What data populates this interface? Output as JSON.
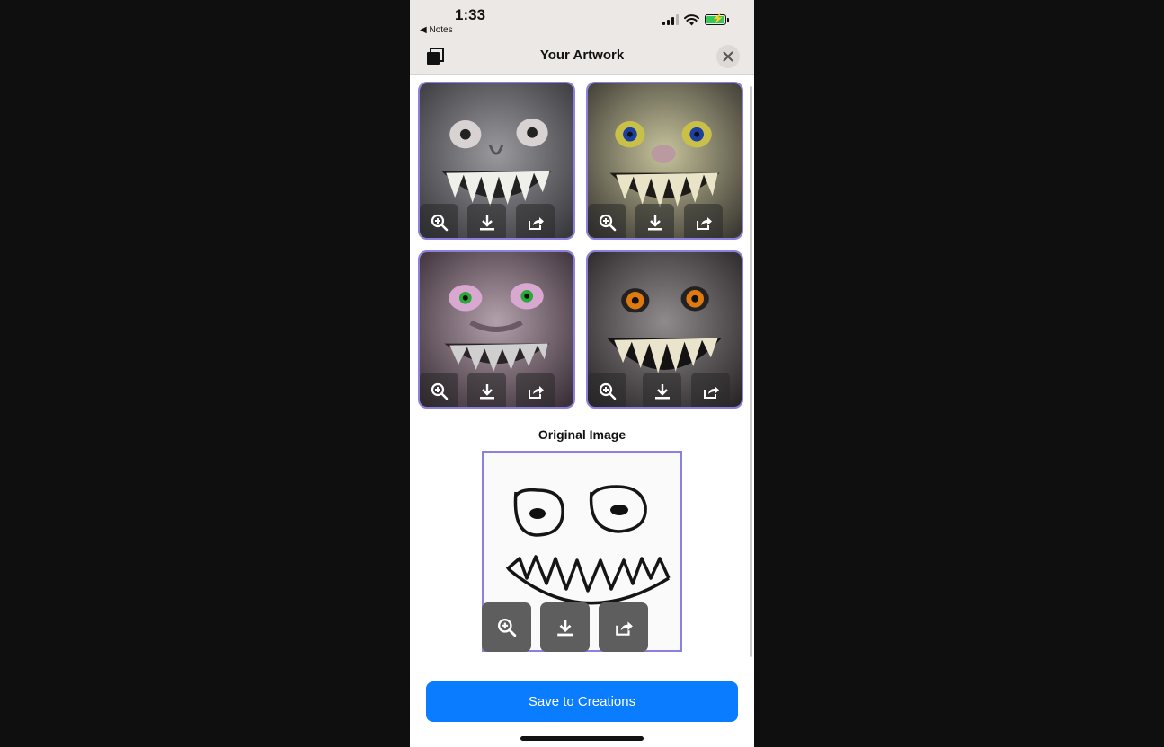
{
  "status_bar": {
    "time": "1:33",
    "back_label": "◀ Notes"
  },
  "header": {
    "title": "Your Artwork"
  },
  "original": {
    "label": "Original Image"
  },
  "actions": {
    "save_label": "Save to Creations"
  },
  "artworks": [
    {
      "id": "artwork-1",
      "eye_color": "#ffffff"
    },
    {
      "id": "artwork-2",
      "eye_color": "#1c3fa0"
    },
    {
      "id": "artwork-3",
      "eye_color": "#2aa83a"
    },
    {
      "id": "artwork-4",
      "eye_color": "#e07a10"
    }
  ],
  "icons": {
    "zoom": "zoom-in-icon",
    "download": "download-icon",
    "share": "share-icon",
    "copy": "copy-icon",
    "close": "close-icon"
  },
  "colors": {
    "accent": "#0a7cff",
    "card_border": "#8b7fe0"
  }
}
